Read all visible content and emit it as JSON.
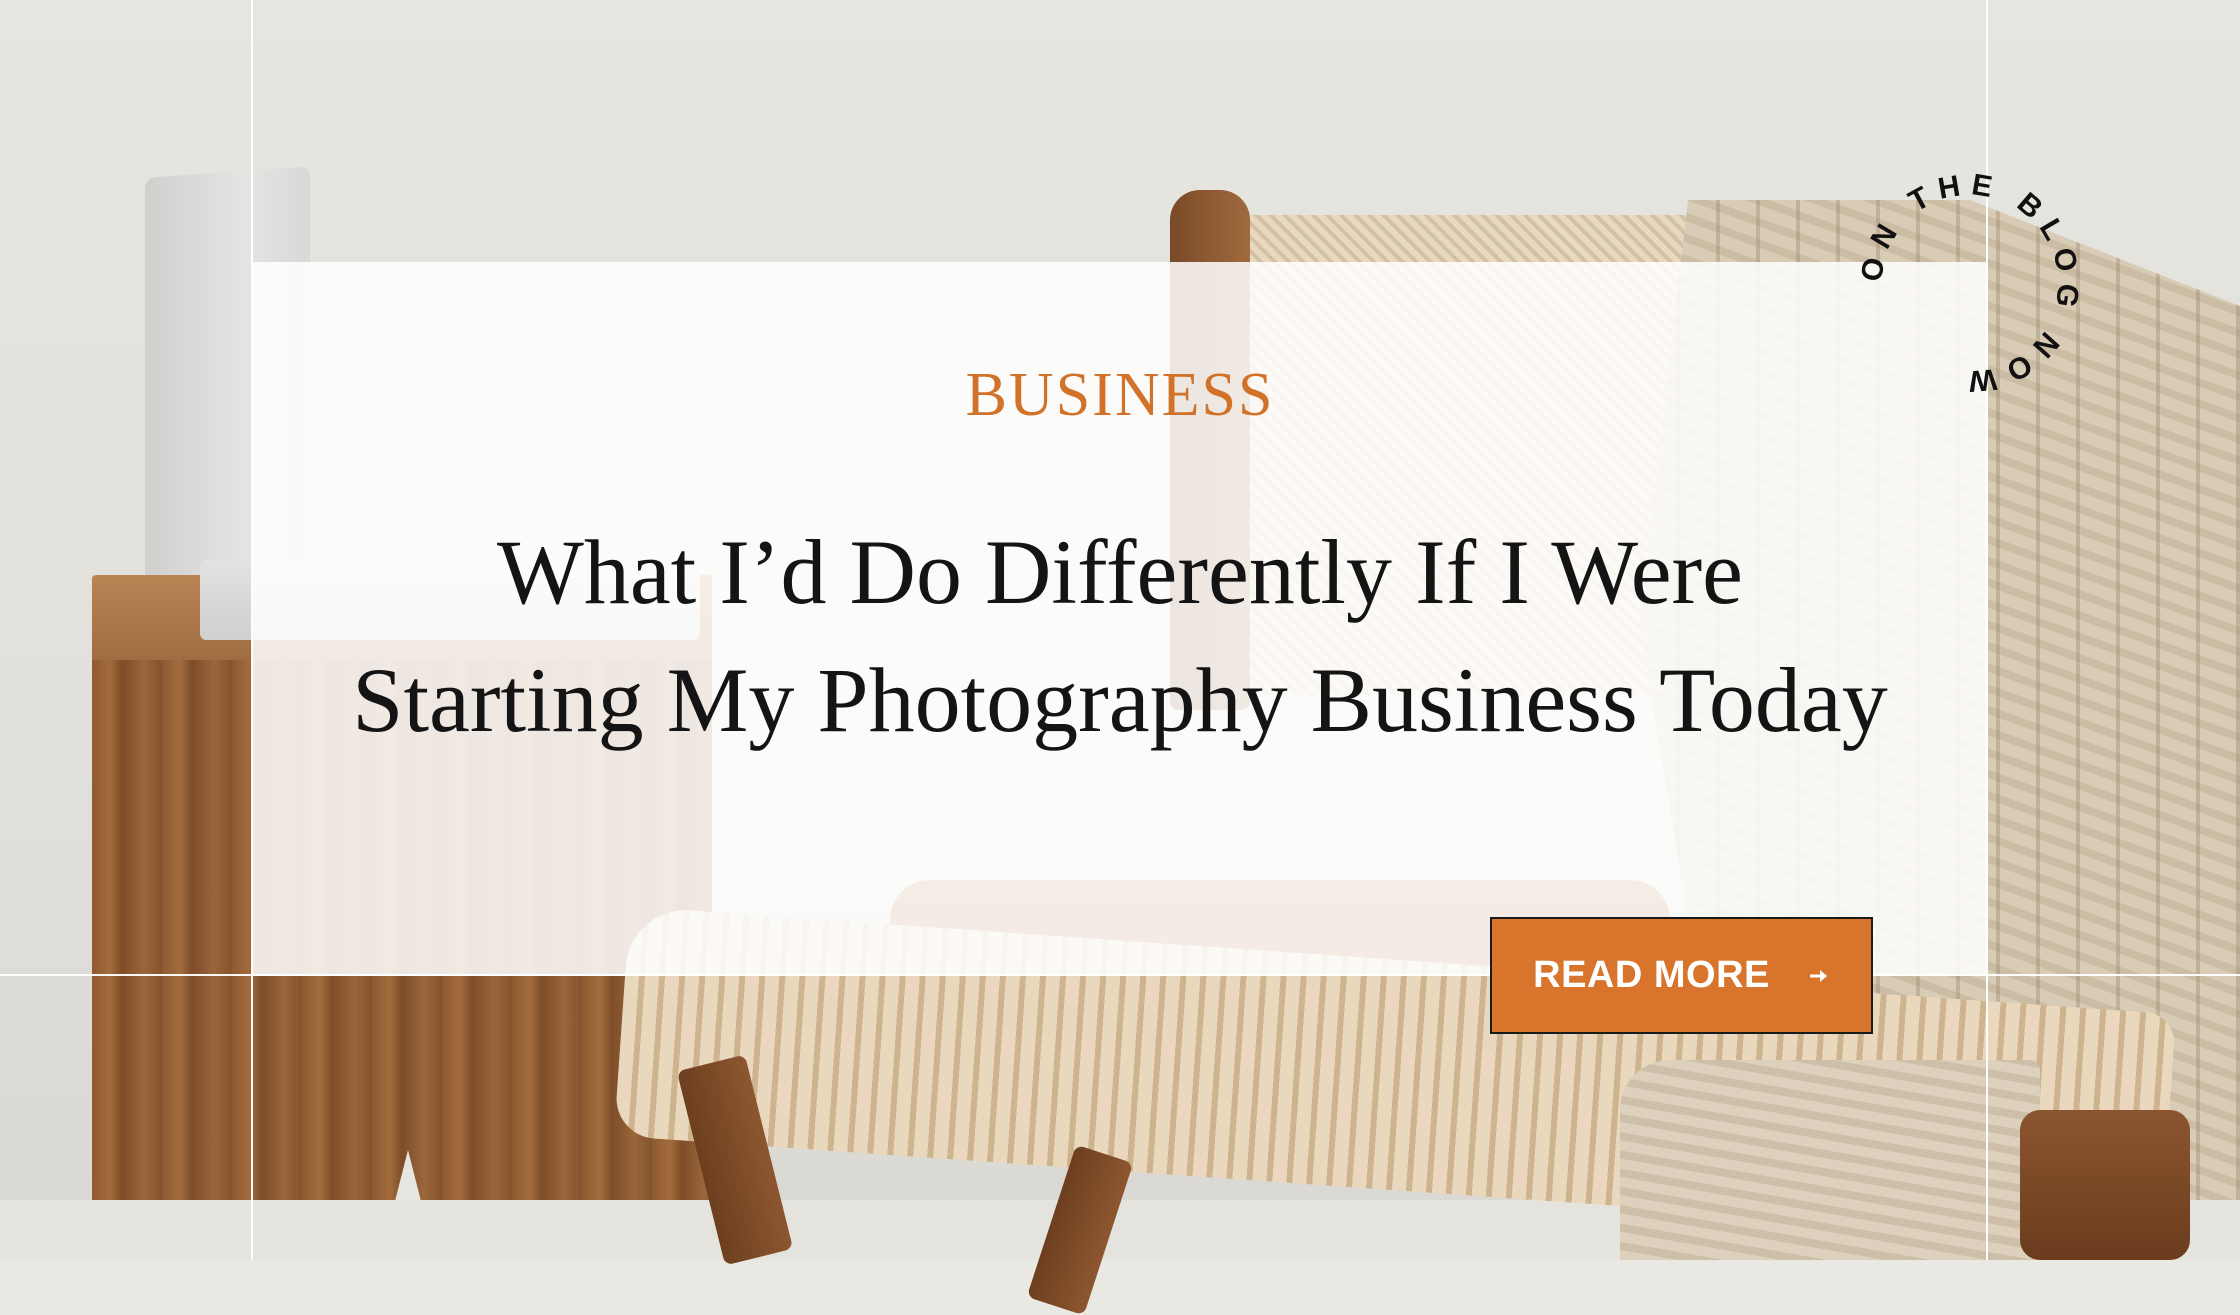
{
  "category": "BUSINESS",
  "headline": {
    "line1": "What I’d Do Differently If I Were",
    "line2": "Starting My Photography Business Today"
  },
  "badge": {
    "text": "ON THE BLOG NOW",
    "icon": "circular-text-badge"
  },
  "button": {
    "label": "READ MORE",
    "icon": "arrow-right-icon"
  },
  "colors": {
    "accent": "#d8742c",
    "category": "#d1722a",
    "headline": "#141414",
    "card": "#ffffff"
  }
}
